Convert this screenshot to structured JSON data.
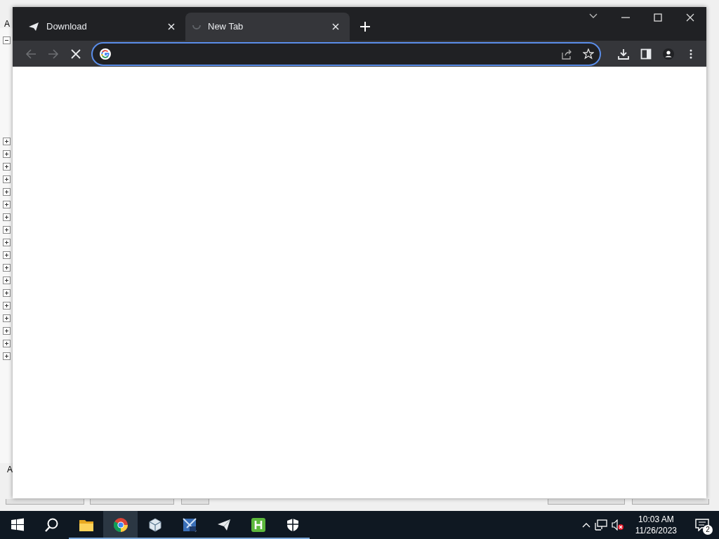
{
  "background_window": {
    "labels": [
      "A",
      "A"
    ],
    "tree_nodes": [
      {
        "expanded": true
      },
      {
        "expanded": false
      },
      {
        "expanded": false
      },
      {
        "expanded": false
      },
      {
        "expanded": false
      },
      {
        "expanded": false
      },
      {
        "expanded": false
      },
      {
        "expanded": false
      },
      {
        "expanded": false
      },
      {
        "expanded": false
      },
      {
        "expanded": false
      },
      {
        "expanded": false
      },
      {
        "expanded": false
      },
      {
        "expanded": false
      },
      {
        "expanded": false
      },
      {
        "expanded": false
      },
      {
        "expanded": false
      },
      {
        "expanded": false
      },
      {
        "expanded": false
      }
    ]
  },
  "browser": {
    "tabs": [
      {
        "title": "Download",
        "selected": false,
        "loading": false
      },
      {
        "title": "New Tab",
        "selected": true,
        "loading": true
      }
    ],
    "toolbar": {
      "back_disabled": true,
      "forward_disabled": true,
      "loading": true
    },
    "address_bar": {
      "focused": true
    }
  },
  "taskbar": {
    "apps": [
      {
        "kind": "start",
        "running": false,
        "selected": false
      },
      {
        "kind": "search",
        "running": false,
        "selected": false
      },
      {
        "kind": "folder",
        "running": true,
        "selected": false
      },
      {
        "kind": "chrome",
        "running": true,
        "selected": true
      },
      {
        "kind": "cube",
        "running": true,
        "selected": false
      },
      {
        "kind": "xp",
        "running": true,
        "selected": false
      },
      {
        "kind": "plane",
        "running": true,
        "selected": false
      },
      {
        "kind": "h",
        "running": true,
        "selected": false
      },
      {
        "kind": "shield",
        "running": true,
        "selected": false
      }
    ],
    "tray": {
      "time": "10:03 AM",
      "date": "11/26/2023",
      "notifications": "2",
      "volume_muted": true
    }
  }
}
